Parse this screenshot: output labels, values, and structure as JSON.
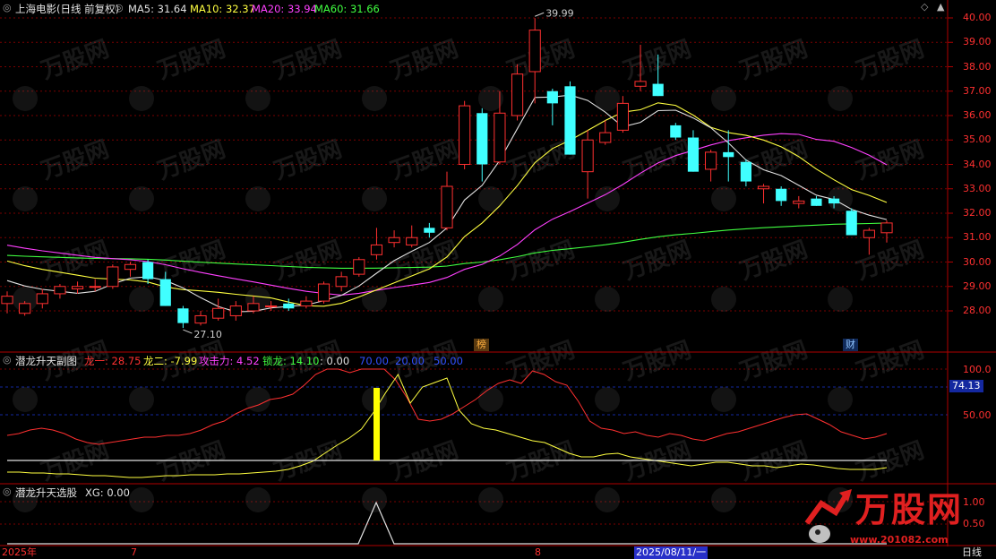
{
  "header": {
    "title": "上海电影(日线 前复权)",
    "ma": [
      {
        "label": "MA5: 31.64",
        "color": "#e0e0e0"
      },
      {
        "label": "MA10: 32.37",
        "color": "#ffff40"
      },
      {
        "label": "MA20: 33.94",
        "color": "#ff40ff"
      },
      {
        "label": "MA60: 31.66",
        "color": "#40ff40"
      }
    ]
  },
  "sub1": {
    "title": "潜龙升天副图",
    "items": [
      {
        "label": "龙一: 28.75",
        "color": "#ff3030"
      },
      {
        "label": "龙二: -7.99",
        "color": "#ffff40"
      },
      {
        "label": "攻击力: 4.52",
        "color": "#ff40ff"
      },
      {
        "label": "锁龙: 14.10",
        "color": "#40ff40"
      },
      {
        "label": ": 0.00",
        "color": "#e0e0e0"
      },
      {
        "label": "70.00",
        "color": "#3050ff"
      },
      {
        "label": "20.00",
        "color": "#3050ff"
      },
      {
        "label": "50.00",
        "color": "#3050ff"
      }
    ],
    "current": "74.13",
    "axis": [
      "100.0",
      "50.00"
    ]
  },
  "sub2": {
    "title": "潜龙升天选股",
    "xg": "XG: 0.00",
    "axis": [
      "1.00",
      "0.50"
    ]
  },
  "price_axis": [
    "40.00",
    "39.00",
    "38.00",
    "37.00",
    "36.00",
    "35.00",
    "34.00",
    "33.00",
    "32.00",
    "31.00",
    "30.00",
    "29.00",
    "28.00"
  ],
  "annotations": {
    "high": "39.99",
    "low": "27.10",
    "bang": "榜",
    "cai": "财"
  },
  "xaxis": {
    "year": "2025年",
    "m7": "7",
    "m8": "8",
    "cursor": "2025/08/11/一",
    "period": "日线"
  },
  "watermark": {
    "brand": "万股网",
    "url": "www.201082.com"
  },
  "colors": {
    "up": "#ff3030",
    "down": "#40ffff",
    "grid": "#8b0000"
  },
  "chart_data": {
    "type": "candlestick",
    "ylim": [
      27.5,
      40.3
    ],
    "candles": [
      {
        "o": 28.3,
        "h": 28.8,
        "l": 27.9,
        "c": 28.6
      },
      {
        "o": 27.9,
        "h": 28.4,
        "l": 27.8,
        "c": 28.3
      },
      {
        "o": 28.3,
        "h": 28.9,
        "l": 28.1,
        "c": 28.7
      },
      {
        "o": 28.7,
        "h": 29.1,
        "l": 28.5,
        "c": 29.0
      },
      {
        "o": 28.9,
        "h": 29.2,
        "l": 28.7,
        "c": 29.0
      },
      {
        "o": 29.0,
        "h": 29.3,
        "l": 28.8,
        "c": 29.0
      },
      {
        "o": 29.0,
        "h": 29.9,
        "l": 28.9,
        "c": 29.8
      },
      {
        "o": 29.7,
        "h": 30.0,
        "l": 29.4,
        "c": 29.9
      },
      {
        "o": 30.0,
        "h": 30.1,
        "l": 29.1,
        "c": 29.3
      },
      {
        "o": 29.3,
        "h": 29.6,
        "l": 28.2,
        "c": 28.2
      },
      {
        "o": 28.1,
        "h": 28.2,
        "l": 27.3,
        "c": 27.5
      },
      {
        "o": 27.5,
        "h": 28.0,
        "l": 27.4,
        "c": 27.8
      },
      {
        "o": 27.7,
        "h": 28.5,
        "l": 27.6,
        "c": 28.1
      },
      {
        "o": 27.8,
        "h": 28.4,
        "l": 27.6,
        "c": 28.2
      },
      {
        "o": 28.0,
        "h": 28.6,
        "l": 27.9,
        "c": 28.3
      },
      {
        "o": 28.2,
        "h": 28.4,
        "l": 28.0,
        "c": 28.2
      },
      {
        "o": 28.3,
        "h": 28.5,
        "l": 28.0,
        "c": 28.1
      },
      {
        "o": 28.2,
        "h": 28.6,
        "l": 28.1,
        "c": 28.4
      },
      {
        "o": 28.4,
        "h": 29.2,
        "l": 28.3,
        "c": 29.1
      },
      {
        "o": 29.0,
        "h": 29.6,
        "l": 28.8,
        "c": 29.4
      },
      {
        "o": 29.5,
        "h": 30.2,
        "l": 29.4,
        "c": 30.1
      },
      {
        "o": 30.3,
        "h": 31.4,
        "l": 30.1,
        "c": 30.7
      },
      {
        "o": 30.8,
        "h": 31.3,
        "l": 30.6,
        "c": 31.0
      },
      {
        "o": 30.7,
        "h": 31.5,
        "l": 30.6,
        "c": 31.0
      },
      {
        "o": 31.4,
        "h": 31.6,
        "l": 31.0,
        "c": 31.2
      },
      {
        "o": 31.4,
        "h": 33.7,
        "l": 31.3,
        "c": 33.1
      },
      {
        "o": 34.0,
        "h": 36.6,
        "l": 33.8,
        "c": 36.4
      },
      {
        "o": 36.1,
        "h": 36.3,
        "l": 33.3,
        "c": 34.0
      },
      {
        "o": 34.1,
        "h": 37.0,
        "l": 34.0,
        "c": 36.1
      },
      {
        "o": 36.0,
        "h": 38.1,
        "l": 35.8,
        "c": 37.7
      },
      {
        "o": 37.8,
        "h": 39.99,
        "l": 36.5,
        "c": 39.5
      },
      {
        "o": 37.0,
        "h": 37.1,
        "l": 35.6,
        "c": 36.5
      },
      {
        "o": 37.2,
        "h": 37.4,
        "l": 34.4,
        "c": 34.4
      },
      {
        "o": 33.7,
        "h": 35.4,
        "l": 32.6,
        "c": 35.0
      },
      {
        "o": 34.9,
        "h": 35.8,
        "l": 34.8,
        "c": 35.3
      },
      {
        "o": 35.4,
        "h": 36.8,
        "l": 35.3,
        "c": 36.5
      },
      {
        "o": 37.2,
        "h": 38.9,
        "l": 37.0,
        "c": 37.4
      },
      {
        "o": 37.3,
        "h": 38.5,
        "l": 36.8,
        "c": 36.8
      },
      {
        "o": 35.6,
        "h": 35.7,
        "l": 35.0,
        "c": 35.1
      },
      {
        "o": 35.1,
        "h": 35.4,
        "l": 33.7,
        "c": 33.7
      },
      {
        "o": 33.8,
        "h": 34.6,
        "l": 33.3,
        "c": 34.5
      },
      {
        "o": 34.5,
        "h": 35.4,
        "l": 33.3,
        "c": 34.3
      },
      {
        "o": 34.1,
        "h": 34.2,
        "l": 33.1,
        "c": 33.3
      },
      {
        "o": 33.0,
        "h": 33.2,
        "l": 32.4,
        "c": 33.1
      },
      {
        "o": 33.0,
        "h": 33.1,
        "l": 32.3,
        "c": 32.5
      },
      {
        "o": 32.4,
        "h": 32.7,
        "l": 32.2,
        "c": 32.5
      },
      {
        "o": 32.6,
        "h": 32.7,
        "l": 32.3,
        "c": 32.3
      },
      {
        "o": 32.6,
        "h": 32.7,
        "l": 32.2,
        "c": 32.4
      },
      {
        "o": 32.1,
        "h": 32.2,
        "l": 31.1,
        "c": 31.1
      },
      {
        "o": 31.0,
        "h": 31.4,
        "l": 30.3,
        "c": 31.3
      },
      {
        "o": 31.2,
        "h": 31.7,
        "l": 30.8,
        "c": 31.6
      }
    ]
  }
}
